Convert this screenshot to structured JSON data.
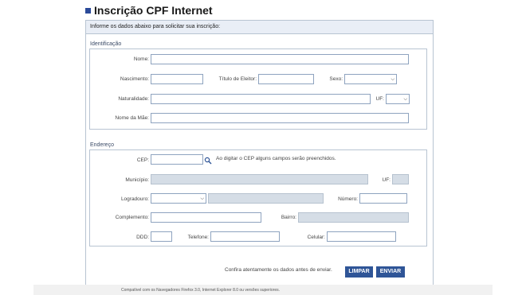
{
  "page": {
    "title": "Inscrição CPF Internet",
    "instructions": "Informe os dados abaixo para solicitar sua inscrição:"
  },
  "identificacao": {
    "legend": "Identificação",
    "nome_label": "Nome:",
    "nome_value": "",
    "nascimento_label": "Nascimento:",
    "nascimento_value": "",
    "titulo_label": "Título de Eleitor:",
    "titulo_value": "",
    "sexo_label": "Sexo:",
    "sexo_value": "",
    "naturalidade_label": "Naturalidade:",
    "naturalidade_value": "",
    "uf_label": "UF:",
    "uf_value": "",
    "mae_label": "Nome da Mãe:",
    "mae_value": ""
  },
  "endereco": {
    "legend": "Endereço",
    "cep_label": "CEP:",
    "cep_value": "",
    "cep_hint": "Ao digitar o CEP alguns campos serão preenchidos.",
    "municipio_label": "Município:",
    "uf_label": "UF:",
    "logradouro_label": "Logradouro:",
    "logradouro_type_value": "",
    "numero_label": "Número:",
    "complemento_label": "Complemento:",
    "bairro_label": "Bairro:",
    "ddd_label": "DDD:",
    "telefone_label": "Telefone:",
    "celular_label": "Celular:"
  },
  "actions": {
    "confirm_note": "Confira atentamente os dados antes de enviar.",
    "limpar_label": "LIMPAR",
    "enviar_label": "ENVIAR"
  },
  "footer": {
    "compat_text": "Compatível com os Navegadores Firefox 3.0, Internet Explorer 8.0 ou versões superiores."
  },
  "icons": {
    "cep_search": "magnifier-icon",
    "select_chevron": "chevron-down-icon"
  },
  "colors": {
    "accent": "#2f5597",
    "bullet": "#2b4a99",
    "border": "#b8c4d2",
    "instr_bg": "#e9eef6",
    "disabled_bg": "#d5dde6"
  }
}
